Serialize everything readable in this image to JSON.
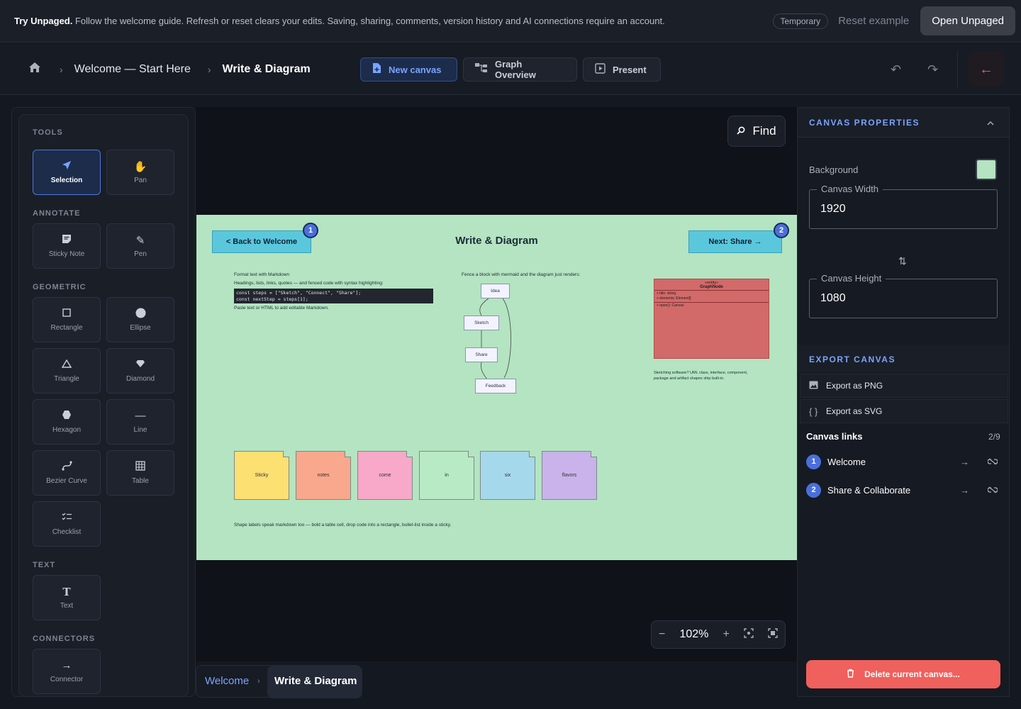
{
  "banner": {
    "title": "Try Unpaged.",
    "message": "Follow the welcome guide. Refresh or reset clears your edits. Saving, sharing, comments, version history and AI connections require an account.",
    "temporary_badge": "Temporary",
    "reset_label": "Reset example",
    "open_label": "Open Unpaged"
  },
  "breadcrumb": {
    "items": [
      "Welcome — Start Here",
      "Write & Diagram"
    ]
  },
  "toolbar": {
    "new_canvas": "New canvas",
    "graph_overview": "Graph Overview",
    "present": "Present"
  },
  "tools": {
    "sections": {
      "tools": "TOOLS",
      "annotate": "ANNOTATE",
      "geometric": "GEOMETRIC",
      "text": "TEXT",
      "connectors": "CONNECTORS"
    },
    "selection": "Selection",
    "pan": "Pan",
    "sticky_note": "Sticky Note",
    "pen": "Pen",
    "rectangle": "Rectangle",
    "ellipse": "Ellipse",
    "triangle": "Triangle",
    "diamond": "Diamond",
    "hexagon": "Hexagon",
    "line": "Line",
    "bezier_curve": "Bezier Curve",
    "table": "Table",
    "checklist": "Checklist",
    "text": "Text",
    "connector": "Connector"
  },
  "canvas": {
    "find_label": "Find",
    "zoom": "102%",
    "back_button": "< Back to Welcome",
    "next_button": "Next: Share →",
    "link_num_1": "1",
    "link_num_2": "2",
    "title": "Write & Diagram",
    "markdown_lines": [
      "Format text with Markdown",
      "Headings, lists, links, quotes — and fenced code with syntax highlighting:"
    ],
    "code_lines": [
      "const steps = [\"Sketch\", \"Connect\", \"Share\"];",
      "const nextStep = steps[1];"
    ],
    "paste_line": "Paste text or HTML to add editable Markdown.",
    "mermaid_caption": "Fence a block with mermaid and the diagram just renders:",
    "nodes": [
      "Idea",
      "Sketch",
      "Share",
      "Feedback"
    ],
    "uml": {
      "stereotype": "«entity»",
      "name": "GraphNode",
      "fields": [
        "+ title: string",
        "+ elements: Element[]"
      ],
      "methods": [
        "+ open(): Canvas"
      ]
    },
    "uml_caption": [
      "Sketching software? UML class, interface, component,",
      "package and artifact shapes ship built-in."
    ],
    "stickies": [
      {
        "label": "Sticky",
        "color": "#fde072"
      },
      {
        "label": "notes",
        "color": "#f9a88d"
      },
      {
        "label": "come",
        "color": "#f8a8c8"
      },
      {
        "label": "in",
        "color": "#b9eac6"
      },
      {
        "label": "six",
        "color": "#a6d8ec"
      },
      {
        "label": "flavors",
        "color": "#c9b3ea"
      }
    ],
    "footer_note": "Shape labels speak markdown too — bold a table cell, drop code into a rectangle, bullet-list inside a sticky.",
    "background_color": "#b4e4c1"
  },
  "bottom_tabs": {
    "items": [
      "Welcome",
      "Write & Diagram"
    ]
  },
  "properties": {
    "section_title": "CANVAS PROPERTIES",
    "background_label": "Background",
    "width_label": "Canvas Width",
    "width_value": "1920",
    "height_label": "Canvas Height",
    "height_value": "1080",
    "export_title": "EXPORT CANVAS",
    "export_png": "Export as PNG",
    "export_svg": "Export as SVG",
    "links_title": "Canvas links",
    "links_count": "2/9",
    "links": [
      {
        "num": "1",
        "label": "Welcome"
      },
      {
        "num": "2",
        "label": "Share & Collaborate"
      }
    ],
    "delete_label": "Delete current canvas..."
  },
  "colors": {
    "accent": "#79a4ff",
    "danger": "#f0605c",
    "canvas_bg": "#b4e4c1",
    "link_badge": "#4a6fdc"
  }
}
